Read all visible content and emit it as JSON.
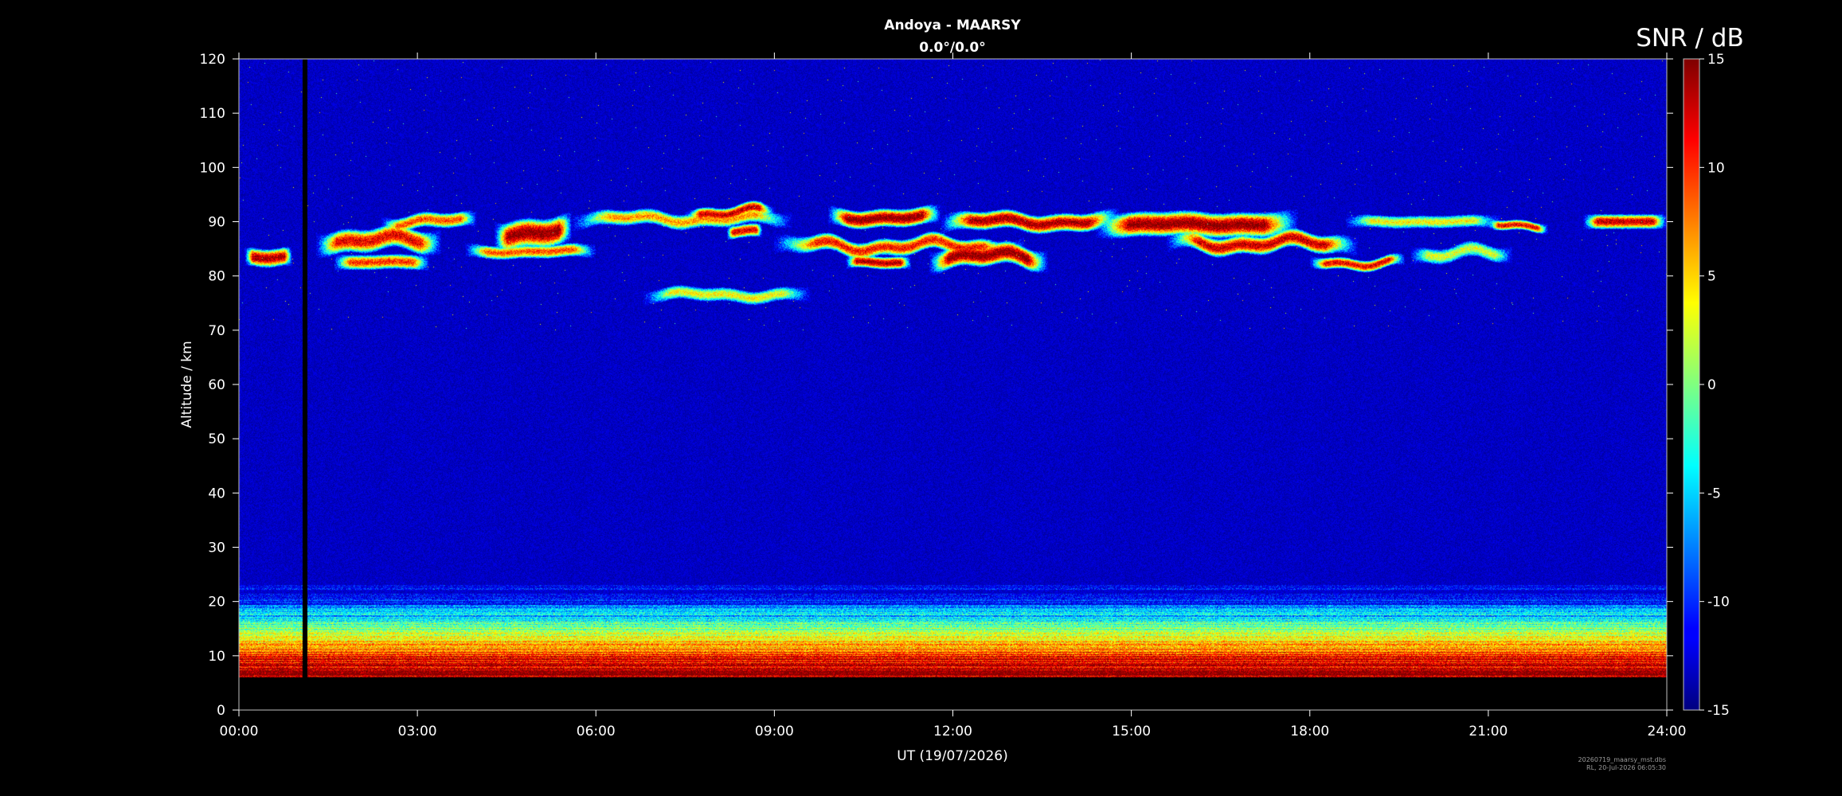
{
  "chart_data": {
    "type": "heatmap",
    "title": "Andoya - MAARSY",
    "subtitle": "0.0°/0.0°",
    "xlabel": "UT (19/07/2026)",
    "ylabel": "Altitude / km",
    "x_ticks": [
      "00:00",
      "03:00",
      "06:00",
      "09:00",
      "12:00",
      "15:00",
      "18:00",
      "21:00",
      "24:00"
    ],
    "xlim": [
      0,
      24
    ],
    "y_ticks": [
      0,
      10,
      20,
      30,
      40,
      50,
      60,
      70,
      80,
      90,
      100,
      110,
      120
    ],
    "ylim": [
      0,
      120
    ],
    "colorbar": {
      "label": "SNR / dB",
      "ticks": [
        15,
        10,
        5,
        0,
        -5,
        -10,
        -15
      ],
      "range": [
        -15,
        15
      ],
      "colormap": "jet"
    },
    "background_snr_db": -13,
    "data_gap_hours": [
      1.07,
      1.15
    ],
    "lowest_altitude_km": 6,
    "echo_layers": [
      {
        "t_start": 0.1,
        "t_end": 0.9,
        "alt_center": 83,
        "thickness": 2.2,
        "snr_peak": 14
      },
      {
        "t_start": 1.3,
        "t_end": 3.4,
        "alt_center": 86.5,
        "thickness": 2.8,
        "snr_peak": 12
      },
      {
        "t_start": 1.6,
        "t_end": 3.2,
        "alt_center": 82.5,
        "thickness": 1.8,
        "snr_peak": 10
      },
      {
        "t_start": 2.4,
        "t_end": 4.0,
        "alt_center": 90,
        "thickness": 1.8,
        "snr_peak": 9
      },
      {
        "t_start": 4.3,
        "t_end": 5.6,
        "alt_center": 88,
        "thickness": 3.5,
        "snr_peak": 15
      },
      {
        "t_start": 3.8,
        "t_end": 6.0,
        "alt_center": 84.5,
        "thickness": 1.6,
        "snr_peak": 9
      },
      {
        "t_start": 5.6,
        "t_end": 9.3,
        "alt_center": 90.5,
        "thickness": 1.8,
        "snr_peak": 7
      },
      {
        "t_start": 7.5,
        "t_end": 9.0,
        "alt_center": 91.5,
        "thickness": 1.6,
        "snr_peak": 13
      },
      {
        "t_start": 8.2,
        "t_end": 8.8,
        "alt_center": 88,
        "thickness": 1.6,
        "snr_peak": 12
      },
      {
        "t_start": 6.8,
        "t_end": 9.6,
        "alt_center": 76.5,
        "thickness": 1.6,
        "snr_peak": 4
      },
      {
        "t_start": 9.0,
        "t_end": 13.2,
        "alt_center": 85.5,
        "thickness": 2.0,
        "snr_peak": 11
      },
      {
        "t_start": 9.9,
        "t_end": 11.8,
        "alt_center": 90.8,
        "thickness": 2.2,
        "snr_peak": 15
      },
      {
        "t_start": 10.2,
        "t_end": 11.3,
        "alt_center": 82.3,
        "thickness": 1.5,
        "snr_peak": 14
      },
      {
        "t_start": 11.6,
        "t_end": 13.6,
        "alt_center": 83.5,
        "thickness": 2.6,
        "snr_peak": 15
      },
      {
        "t_start": 11.8,
        "t_end": 14.8,
        "alt_center": 90,
        "thickness": 2.2,
        "snr_peak": 14
      },
      {
        "t_start": 14.4,
        "t_end": 17.8,
        "alt_center": 89.5,
        "thickness": 3.0,
        "snr_peak": 15
      },
      {
        "t_start": 15.6,
        "t_end": 18.8,
        "alt_center": 86,
        "thickness": 2.2,
        "snr_peak": 13
      },
      {
        "t_start": 18.0,
        "t_end": 19.6,
        "alt_center": 82.5,
        "thickness": 1.4,
        "snr_peak": 12
      },
      {
        "t_start": 18.6,
        "t_end": 21.2,
        "alt_center": 90,
        "thickness": 1.5,
        "snr_peak": 4
      },
      {
        "t_start": 19.7,
        "t_end": 21.4,
        "alt_center": 84,
        "thickness": 1.8,
        "snr_peak": 3
      },
      {
        "t_start": 21.0,
        "t_end": 22.0,
        "alt_center": 89.5,
        "thickness": 1.2,
        "snr_peak": 12
      },
      {
        "t_start": 22.6,
        "t_end": 24.0,
        "alt_center": 90,
        "thickness": 1.8,
        "snr_peak": 13
      }
    ],
    "lower_atmosphere": [
      {
        "alt_km": 7,
        "snr_db": 14
      },
      {
        "alt_km": 10,
        "snr_db": 11
      },
      {
        "alt_km": 12,
        "snr_db": 6
      },
      {
        "alt_km": 15,
        "snr_db": 1
      },
      {
        "alt_km": 18,
        "snr_db": -6
      },
      {
        "alt_km": 20,
        "snr_db": -11
      },
      {
        "alt_km": 22,
        "snr_db": -13
      }
    ]
  },
  "footer": {
    "filename": "20260719_maarsy_mst.dbs",
    "stamp": "RL, 20-Jul-2026 06:05:30"
  }
}
